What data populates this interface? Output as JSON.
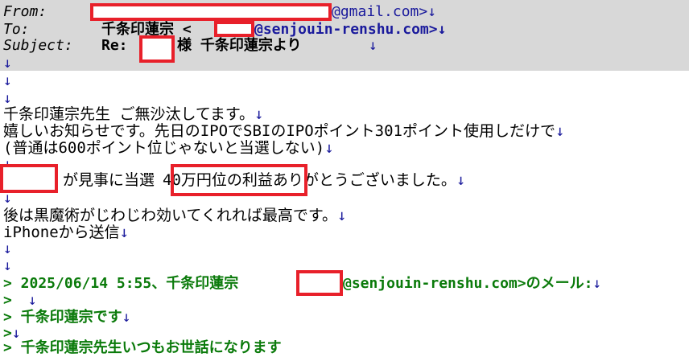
{
  "header": {
    "from_label": "From:",
    "from_addr": "@gmail.com>↓",
    "to_label": "To:",
    "to_name": "千条印蓮宗 <",
    "to_addr": "@senjouin-renshu.com>↓",
    "subject_label": "Subject:",
    "subject_re": "Re:",
    "subject_rest": "様 千条印蓮宗より",
    "subject_arrow": "↓"
  },
  "arrow": "↓",
  "body": {
    "greeting": "千条印蓮宗先生 ご無沙汰してます。",
    "line2": "嬉しいお知らせです。先日のIPOでSBIのIPOポイント301ポイント使用しだけで",
    "line3": "(普通は600ポイント位じゃないと当選しない)",
    "line5a": "が見事に当選",
    "line5b": "40万円位の利益",
    "line5c": "ありがとうございました。",
    "line7": "後は黒魔術がじわじわ効いてくれれば最高です。",
    "line8": "iPhoneから送信"
  },
  "quote": {
    "q1a": "> 2025/06/14 5:55、千条印蓮宗",
    "q1b": "@senjouin-renshu.com>のメール:",
    "q2": ">",
    "q3": "> 千条印蓮宗です",
    "q4": ">",
    "q5": "> 千条印蓮宗先生いつもお世話になります"
  }
}
